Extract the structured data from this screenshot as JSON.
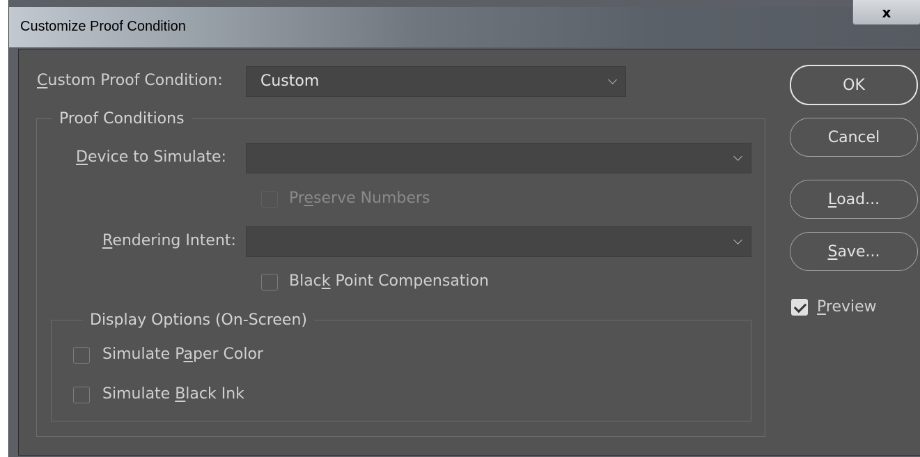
{
  "window": {
    "title": "Customize Proof Condition",
    "close_glyph": "x"
  },
  "custom_condition": {
    "label_accel": "C",
    "label_rest": "ustom Proof Condition:",
    "value": "Custom"
  },
  "proof_conditions": {
    "legend": "Proof Conditions",
    "device": {
      "label_accel": "D",
      "label_rest": "evice to Simulate:",
      "value": ""
    },
    "preserve_numbers": {
      "pre": "Pr",
      "accel": "e",
      "post": "serve Numbers",
      "checked": false,
      "enabled": false
    },
    "rendering_intent": {
      "label_accel": "R",
      "label_rest": "endering Intent:",
      "value": ""
    },
    "black_point": {
      "pre": "Blac",
      "accel": "k",
      "post": " Point Compensation",
      "checked": false
    }
  },
  "display_options": {
    "legend": "Display Options (On-Screen)",
    "paper_color": {
      "pre": "Simulate P",
      "accel": "a",
      "post": "per Color",
      "checked": false
    },
    "black_ink": {
      "pre": "Simulate ",
      "accel": "B",
      "post": "lack Ink",
      "checked": false
    }
  },
  "buttons": {
    "ok": "OK",
    "cancel": "Cancel",
    "load_accel": "L",
    "load_rest": "oad...",
    "save_accel": "S",
    "save_rest": "ave..."
  },
  "preview": {
    "accel": "P",
    "rest": "review",
    "checked": true
  }
}
